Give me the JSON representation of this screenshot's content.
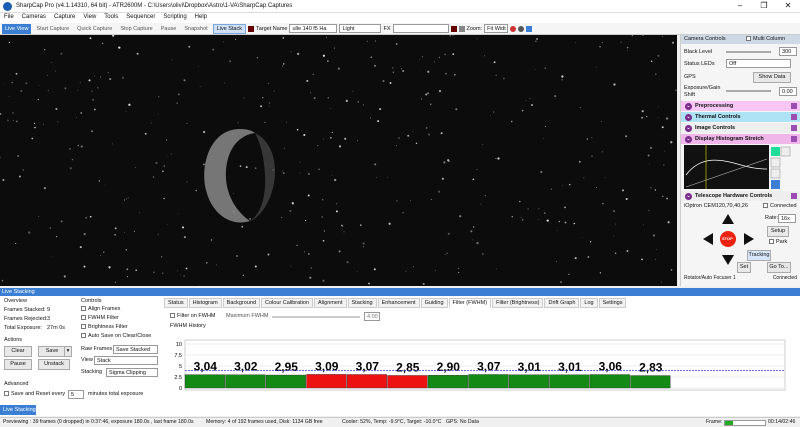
{
  "window": {
    "title": "SharpCap Pro (v4.1.14310, 64 bit) - ATR2600M - C:\\Users\\olivi\\Dropbox\\Astro\\1-VA\\SharpCap Captures"
  },
  "menu": [
    "File",
    "Cameras",
    "Capture",
    "View",
    "Tools",
    "Sequencer",
    "Scripting",
    "Help"
  ],
  "toolbar": {
    "live_view": "Live View",
    "start_capture": "Start Capture",
    "quick_capture": "Quick Capture",
    "stop_capture": "Stop Capture",
    "pause": "Pause",
    "snapshot": "Snapshot",
    "live_stack": "Live Stack",
    "target_name_label": "Target Name",
    "target_name_value": "ulle 140 f5 Ha",
    "profile": "Light",
    "fx_label": "FX",
    "zoom_label": "Zoom:",
    "zoom_value": "Fit Widt"
  },
  "camera_controls": {
    "title": "Camera Controls",
    "multi_column": "Multi Column",
    "black_level_label": "Black Level",
    "black_level_value": "300",
    "status_leds_label": "Status LEDs",
    "status_leds_value": "Off",
    "gps_label": "GPS",
    "show_data": "Show Data",
    "exposure_label": "Exposure/Gain Shift",
    "exposure_value": "0.00",
    "sections": [
      "Preprocessing",
      "Thermal Controls",
      "Image Controls",
      "Display Histogram Stretch"
    ],
    "telescope": {
      "title": "Telescope Hardware Controls",
      "mount": "iOptron CEM120,70,40,26",
      "connected": "Connected",
      "rate_label": "Rate:",
      "rate_value": "16x",
      "setup": "Setup",
      "park": "Park",
      "stop": "STOP",
      "tracking": "Tracking",
      "set": "Set",
      "goto": "Go To...",
      "next_section": "Rotator/Auto Focuser 1",
      "next_connected": "Connected"
    }
  },
  "live_stacking": {
    "title": "Live Stacking",
    "overview": {
      "title": "Overview",
      "frames_stacked_label": "Frames Stacked:",
      "frames_stacked": "9",
      "frames_rejected_label": "Frames Rejected:",
      "frames_rejected": "3",
      "total_exposure_label": "Total Exposure:",
      "total_exposure": "27m 0s"
    },
    "actions": {
      "title": "Actions",
      "clear": "Clear",
      "save": "Save",
      "pause": "Pause",
      "unstack": "Unstack"
    },
    "advanced": {
      "title": "Advanced",
      "save_reset_label": "Save and Reset every",
      "save_reset_value": "5",
      "save_reset_suffix": "minutes total exposure"
    },
    "controls": {
      "title": "Controls",
      "align_frames": "Align Frames",
      "fwhm_filter": "FWHM Filter",
      "brightness_filter": "Brightness Filter",
      "auto_save": "Auto Save on Clear/Close",
      "raw_frames_label": "Raw Frames",
      "raw_frames_value": "Save Stacked",
      "view_label": "View",
      "view_value": "Stack",
      "stacking_label": "Stacking",
      "stacking_value": "Sigma Clipping"
    },
    "tabs": [
      "Status",
      "Histogram",
      "Background",
      "Colour Calibration",
      "Alignment",
      "Stacking",
      "Enhancement",
      "Guiding",
      "Filter (FWHM)",
      "Filter (Brightness)",
      "Drift Graph",
      "Log",
      "Settings"
    ],
    "active_tab": "Filter (FWHM)",
    "filter": {
      "filter_on_fwhm": "Filter on FWHM",
      "max_fwhm_label": "Maximum FWHM",
      "max_fwhm_value": "4.00",
      "history_label": "FWHM History"
    }
  },
  "chart_data": {
    "type": "bar",
    "values": [
      3.04,
      3.02,
      2.95,
      3.09,
      3.07,
      2.85,
      2.9,
      3.07,
      3.01,
      3.01,
      3.06,
      2.83
    ],
    "labels": [
      "3,04",
      "3,02",
      "2,95",
      "3,09",
      "3,07",
      "2,85",
      "2,90",
      "3,07",
      "3,01",
      "3,01",
      "3,06",
      "2,83"
    ],
    "colors": [
      "#138a13",
      "#138a13",
      "#138a13",
      "#ee1111",
      "#ee1111",
      "#ee1111",
      "#138a13",
      "#138a13",
      "#138a13",
      "#138a13",
      "#138a13",
      "#138a13"
    ],
    "yticks": [
      "10",
      "7.5",
      "5",
      "2.5",
      "0"
    ],
    "ylim": [
      0,
      10
    ],
    "threshold": 4.0
  },
  "live_tab": "Live Stacking",
  "status": {
    "text": "Previewing : 39 frames (0 dropped) in 0:37:46, exposure 180.0s , last frame 180.0s",
    "memory": "Memory: 4 of 192 frames used, Disk: 1134 GB free",
    "cooler": "Cooler: 52%, Temp: -9.9°C, Target: -10.0°C",
    "gps": "GPS: No Data",
    "frame_label": "Frame:",
    "time": "00:14/02:46"
  }
}
